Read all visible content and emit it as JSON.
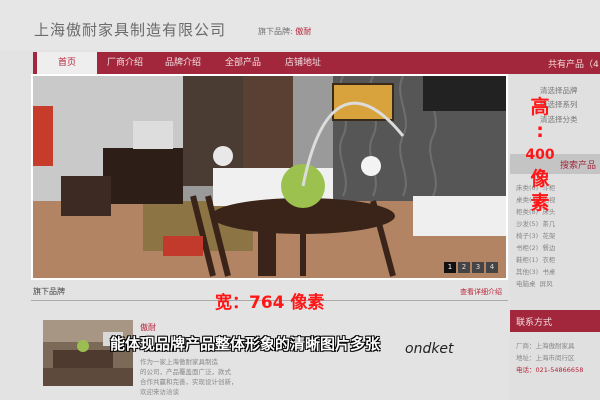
{
  "header": {
    "company_name": "上海傲耐家具制造有限公司",
    "brand_label": "旗下品牌: ",
    "brand_name": "傲耐"
  },
  "nav": {
    "items": [
      "首页",
      "厂商介绍",
      "品牌介绍",
      "全部产品",
      "店铺地址"
    ],
    "active_index": 0
  },
  "hero": {
    "slides": [
      "1",
      "2",
      "3",
      "4"
    ],
    "active_slide": 1
  },
  "annotations": {
    "height_label": [
      "高",
      ":",
      "400",
      "像",
      "素"
    ],
    "width_label": "宽：764 像素",
    "caption": "能体现品牌产品整体形象的清晰图片多张",
    "watermark": "ondket"
  },
  "section": {
    "title": "旗下品牌",
    "more": "查看详细介绍"
  },
  "brand_block": {
    "name": "傲耐",
    "desc_lines": [
      "作为一家上海傲耐家具制造",
      "的公司，产品覆盖面广泛，款式",
      "合作共赢和完善，实现设计创新，",
      "欢迎来访洽谈"
    ]
  },
  "right_col": {
    "products_title": "共有产品（4",
    "lines": [
      "清选择品牌",
      "清选择系列",
      "清选择分类"
    ],
    "search_title": "搜索产品",
    "categories": [
      [
        "床类(6)",
        "斗柜"
      ],
      [
        "桌类(4)",
        "电视"
      ],
      [
        "柜类(8)",
        "床头"
      ],
      [
        "沙发(5)",
        "茶几"
      ],
      [
        "椅子(3)",
        "花架"
      ],
      [
        "书柜(2)",
        "餐边"
      ],
      [
        "鞋柜(1)",
        "衣柜"
      ],
      [
        "其他(3)",
        "书桌"
      ],
      [
        "电脑桌",
        "屏风"
      ]
    ],
    "contact_title": "联系方式",
    "contact_lines": [
      "厂商：上海傲耐家具",
      "地址：上海市闵行区",
      "电话：021-54866658"
    ]
  },
  "colors": {
    "accent": "#a2273c",
    "overlay_red": "#ff1717"
  }
}
